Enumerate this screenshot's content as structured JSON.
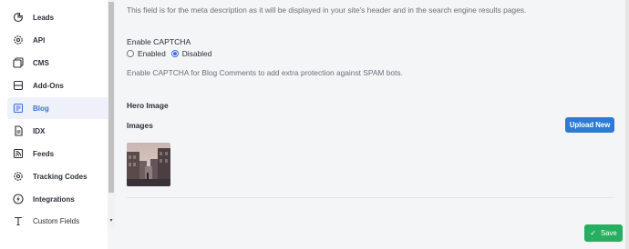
{
  "sidebar": {
    "items": [
      {
        "label": "Leads",
        "icon": "leads-icon"
      },
      {
        "label": "API",
        "icon": "gear-icon"
      },
      {
        "label": "CMS",
        "icon": "cms-icon"
      },
      {
        "label": "Add-Ons",
        "icon": "addons-icon"
      },
      {
        "label": "Blog",
        "icon": "blog-icon",
        "active": true
      },
      {
        "label": "IDX",
        "icon": "idx-icon"
      },
      {
        "label": "Feeds",
        "icon": "feeds-icon"
      },
      {
        "label": "Tracking Codes",
        "icon": "gear-icon"
      },
      {
        "label": "Integrations",
        "icon": "lightning-icon"
      },
      {
        "label": "Custom Fields",
        "icon": "text-icon"
      }
    ]
  },
  "main": {
    "meta_description_help": "This field is for the meta description as it will be displayed in your site's header and in the search engine results pages.",
    "captcha": {
      "label": "Enable CAPTCHA",
      "options": [
        "Enabled",
        "Disabled"
      ],
      "selected": "Disabled",
      "help": "Enable CAPTCHA for Blog Comments to add extra protection against SPAM bots."
    },
    "hero_image_label": "Hero Image",
    "images_label": "Images",
    "upload_button": "Upload New"
  },
  "footer": {
    "save_button": "Save"
  },
  "colors": {
    "accent_blue": "#2e7bd6",
    "active_text": "#3b6fd8",
    "save_green": "#27ae60"
  }
}
